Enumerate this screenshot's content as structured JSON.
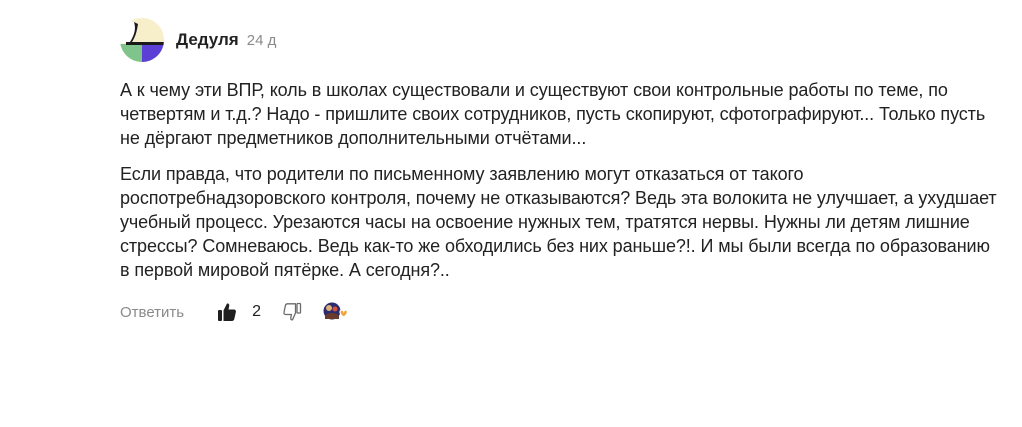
{
  "comment": {
    "author": "Дедуля",
    "time": "24 д",
    "paragraphs": [
      "А к чему эти ВПР, коль в школах существовали и существуют свои контрольные работы по теме, по четвертям и т.д.? Надо - пришлите своих сотрудников, пусть скопируют, сфотографируют... Только пусть не дёргают предметников дополнительными отчётами...",
      "Если правда, что родители по письменному заявлению могут отказаться от такого роспотребнадзоровского контроля, почему не отказываются? Ведь эта волокита не улучшает, а ухудшает учебный процесс. Урезаются часы на освоение нужных тем, тратятся нервы. Нужны ли детям лишние стрессы? Сомневаюсь. Ведь как-то же обходились без них раньше?!. И мы были всегда по образованию в первой мировой пятёрке. А сегодня?.."
    ],
    "actions": {
      "reply_label": "Ответить",
      "like_count": "2"
    },
    "icons": {
      "like": "thumbs-up-icon",
      "dislike": "thumbs-down-icon",
      "reactions": "reactions-icon"
    },
    "colors": {
      "avatar_top": "#f6efc9",
      "avatar_mid": "#1a1a1a",
      "avatar_green": "#7fc48a",
      "avatar_purple": "#5b3fd6"
    }
  }
}
